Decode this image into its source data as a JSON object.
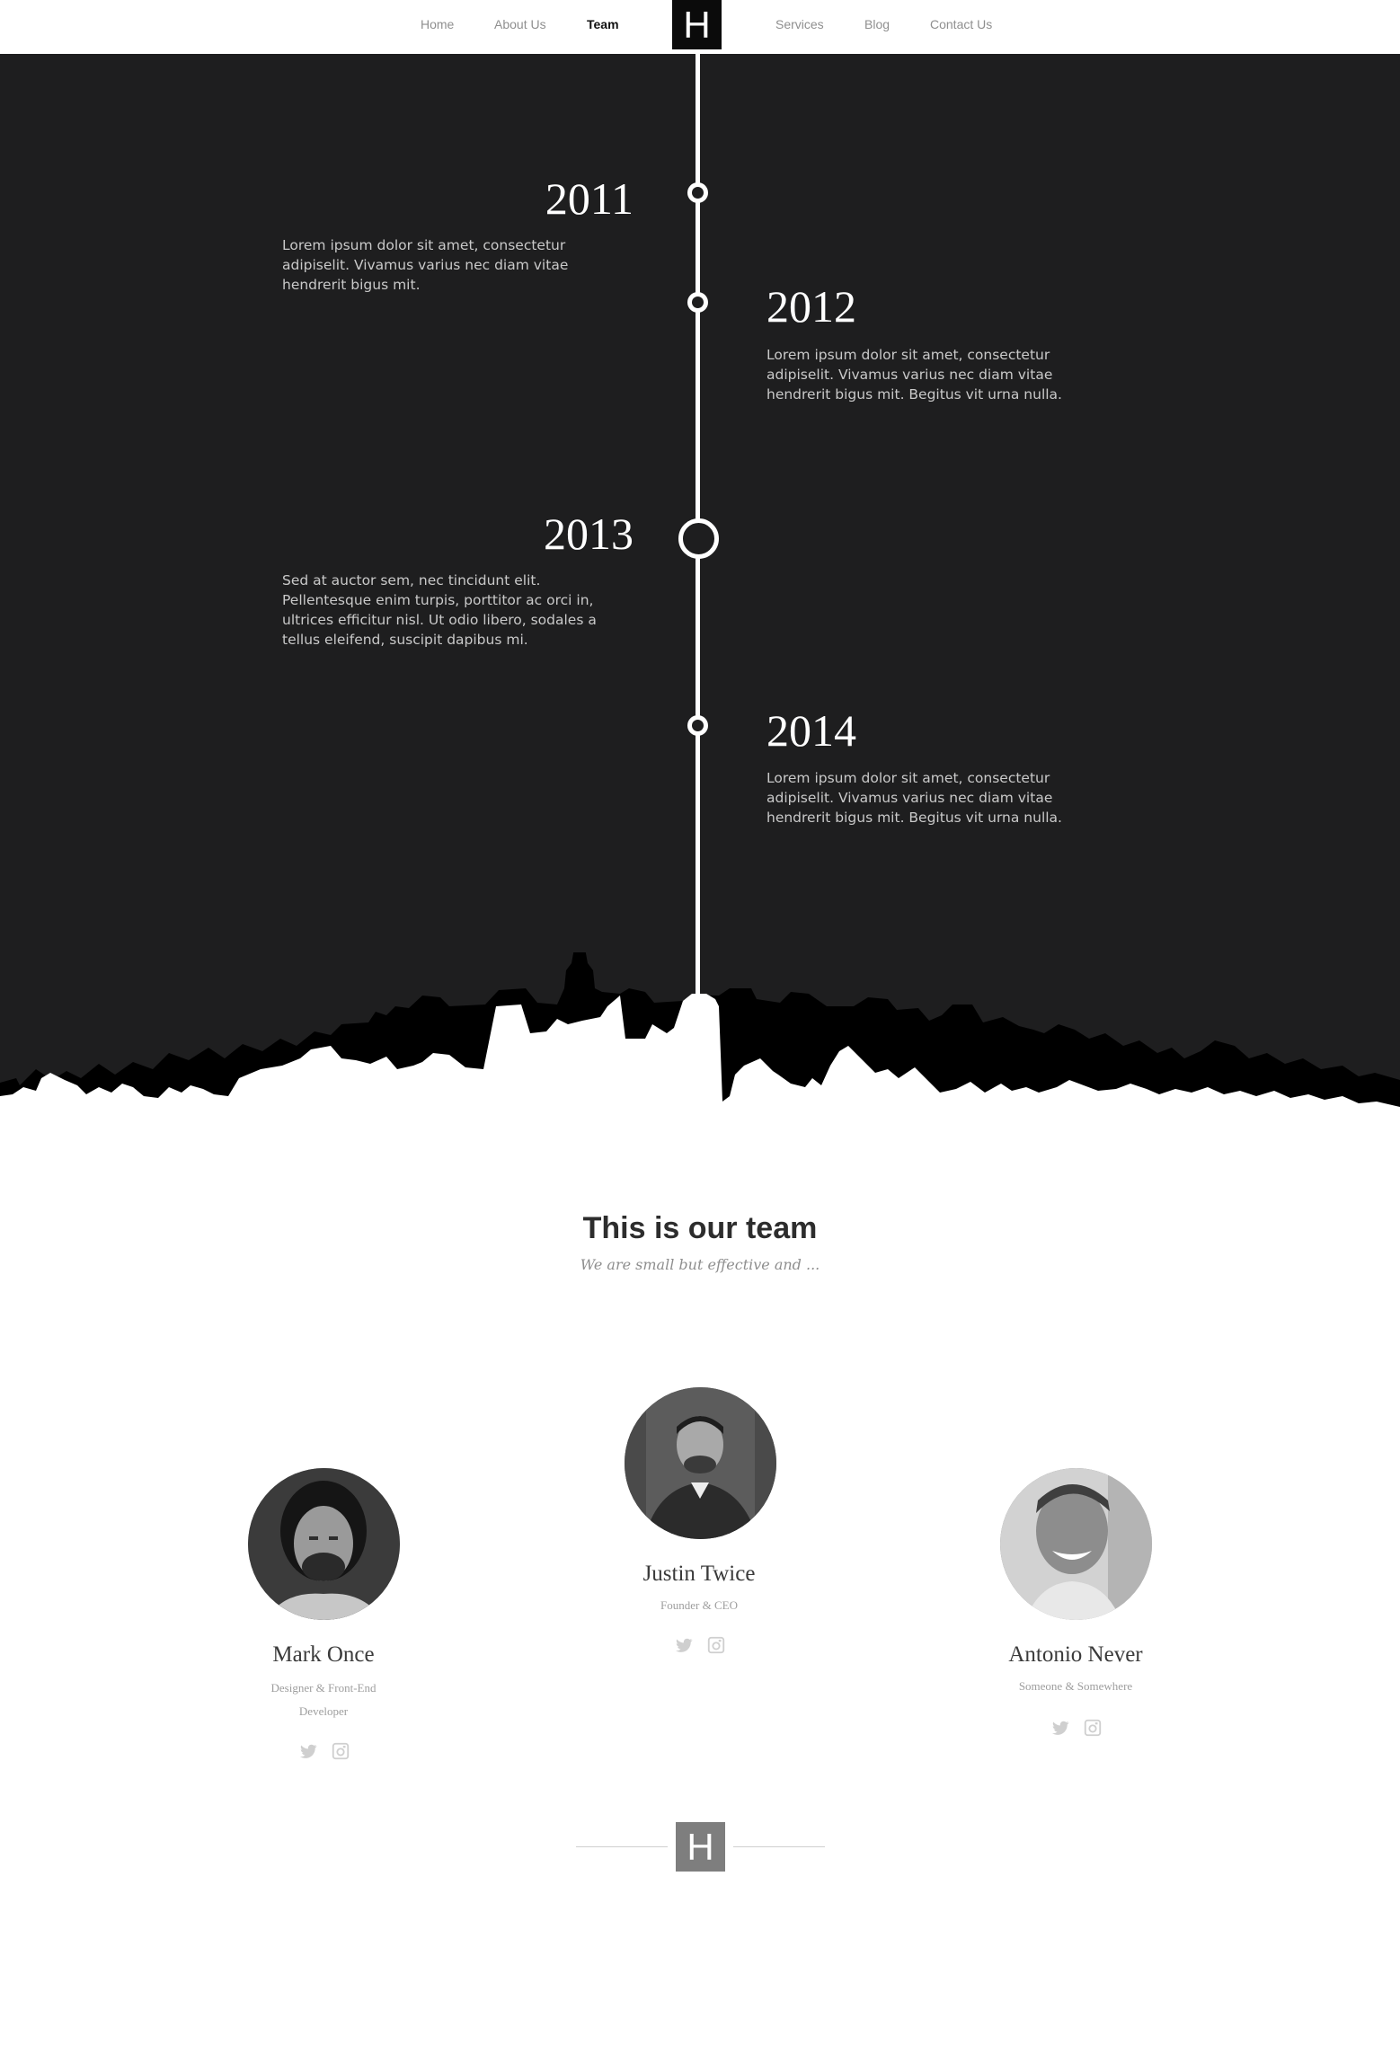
{
  "nav": {
    "items": [
      {
        "label": "Home"
      },
      {
        "label": "About Us"
      },
      {
        "label": "Team"
      },
      {
        "label": "Services"
      },
      {
        "label": "Blog"
      },
      {
        "label": "Contact Us"
      }
    ],
    "active": "Team",
    "logo": "H"
  },
  "timeline": {
    "entries": [
      {
        "year": "2011",
        "text": "Lorem ipsum dolor sit amet, consectetur adipiselit. Vivamus varius nec diam vitae hendrerit bigus mit."
      },
      {
        "year": "2012",
        "text": "Lorem ipsum dolor sit amet, consectetur adipiselit. Vivamus varius nec diam vitae hendrerit bigus mit. Begitus vit urna nulla."
      },
      {
        "year": "2013",
        "text": "Sed at auctor sem, nec tincidunt elit. Pellentesque enim turpis, porttitor ac orci in, ultrices efficitur nisl. Ut odio libero, sodales a tellus eleifend, suscipit dapibus mi."
      },
      {
        "year": "2014",
        "text": "Lorem ipsum dolor sit amet, consectetur adipiselit. Vivamus varius nec diam vitae hendrerit bigus mit. Begitus vit urna nulla."
      }
    ]
  },
  "team": {
    "title": "This is our team",
    "subtitle": "We are small but effective and ...",
    "members": [
      {
        "name": "Mark Once",
        "role": "Designer & Front-End Developer"
      },
      {
        "name": "Justin Twice",
        "role": "Founder & CEO"
      },
      {
        "name": "Antonio Never",
        "role": "Someone & Somewhere"
      }
    ],
    "social_icons": [
      "twitter-icon",
      "instagram-icon"
    ]
  },
  "footer": {
    "logo": "H"
  },
  "colors": {
    "dark_bg": "#1e1e1f",
    "accent_white": "#ffffff",
    "muted_text": "#9e9e9e",
    "footer_logo": "#7e7e7e"
  }
}
